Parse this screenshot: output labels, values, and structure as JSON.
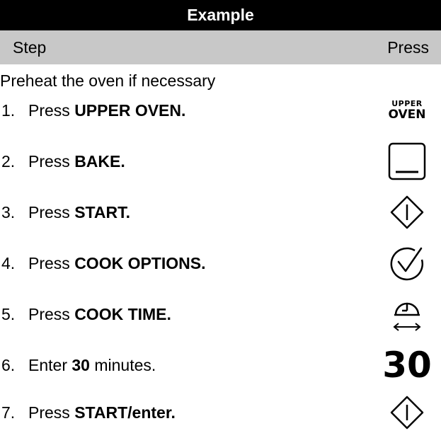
{
  "title": "Example",
  "header": {
    "step": "Step",
    "press": "Press"
  },
  "intro": "Preheat the oven if necessary",
  "steps": [
    {
      "num": "1.",
      "pre": "Press ",
      "bold": "UPPER OVEN.",
      "post": "",
      "icon": "upper-oven-label",
      "icon_text_1": "UPPER",
      "icon_text_2": "OVEN"
    },
    {
      "num": "2.",
      "pre": "Press ",
      "bold": "BAKE.",
      "post": "",
      "icon": "bake-icon"
    },
    {
      "num": "3.",
      "pre": "Press ",
      "bold": "START.",
      "post": "",
      "icon": "start-icon"
    },
    {
      "num": "4.",
      "pre": "Press ",
      "bold": "COOK OPTIONS.",
      "post": "",
      "icon": "cook-options-icon"
    },
    {
      "num": "5.",
      "pre": "Press ",
      "bold": "COOK TIME.",
      "post": "",
      "icon": "cook-time-icon"
    },
    {
      "num": "6.",
      "pre": "Enter ",
      "bold": "30",
      "post": " minutes.",
      "icon": "number-30",
      "icon_text": "30"
    },
    {
      "num": "7.",
      "pre": "Press ",
      "bold": "START/enter.",
      "post": "",
      "icon": "start-enter-icon"
    }
  ]
}
